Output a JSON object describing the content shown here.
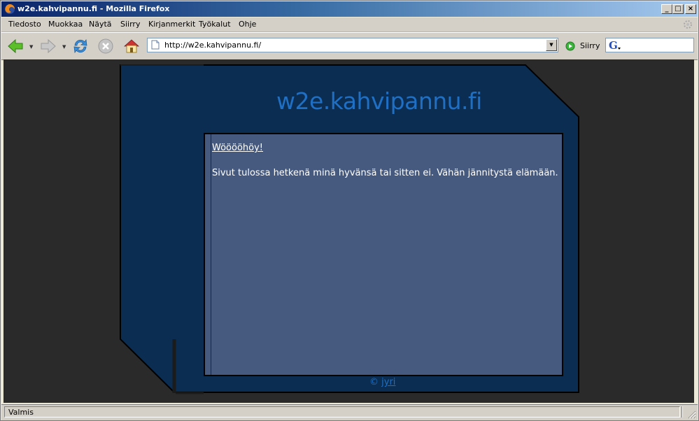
{
  "window": {
    "title": "w2e.kahvipannu.fi - Mozilla Firefox",
    "buttons": {
      "minimize": "_",
      "maximize": "□",
      "close": "×"
    }
  },
  "menu": {
    "items": [
      {
        "label": "Tiedosto"
      },
      {
        "label": "Muokkaa"
      },
      {
        "label": "Näytä"
      },
      {
        "label": "Siirry"
      },
      {
        "label": "Kirjanmerkit"
      },
      {
        "label": "Työkalut"
      },
      {
        "label": "Ohje"
      }
    ]
  },
  "navbar": {
    "back_icon": "back-arrow-icon",
    "forward_icon": "forward-arrow-icon",
    "reload_icon": "reload-icon",
    "stop_icon": "stop-icon",
    "home_icon": "home-icon",
    "url": "http://w2e.kahvipannu.fi/",
    "go_label": "Siirry",
    "search_engine": "G",
    "search_value": ""
  },
  "page": {
    "site_title": "w2e.kahvipannu.fi",
    "heading": "Wööööhöy!",
    "body_text": "Sivut tulossa hetkenä minä hyvänsä tai sitten ei. Vähän jännitystä elämään.",
    "footer_symbol": "©",
    "footer_link": "jyri"
  },
  "status": {
    "text": "Valmis"
  },
  "colors": {
    "page_background": "#2a2a2a",
    "frame": "#0b2d52",
    "panel": "#465a80",
    "title_text": "#1f6fc4",
    "link": "#1f6fc4",
    "titlebar_start": "#0a246a",
    "titlebar_end": "#a6caf0"
  }
}
